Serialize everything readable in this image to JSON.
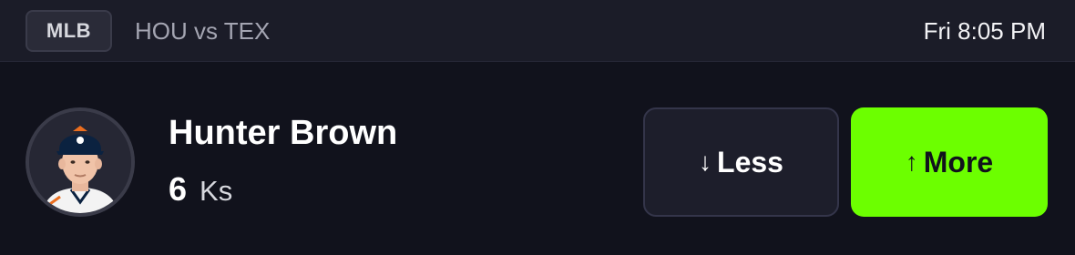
{
  "header": {
    "league": "MLB",
    "matchup": "HOU vs TEX",
    "game_time": "Fri 8:05 PM"
  },
  "player": {
    "name": "Hunter Brown",
    "stat_value": "6",
    "stat_unit": "Ks",
    "avatar_icon": "player-headshot"
  },
  "actions": {
    "less_label": "Less",
    "less_icon": "arrow-down-icon",
    "more_label": "More",
    "more_icon": "arrow-up-icon"
  },
  "colors": {
    "background": "#11121c",
    "header": "#1b1c28",
    "accent_green": "#6cff00"
  }
}
